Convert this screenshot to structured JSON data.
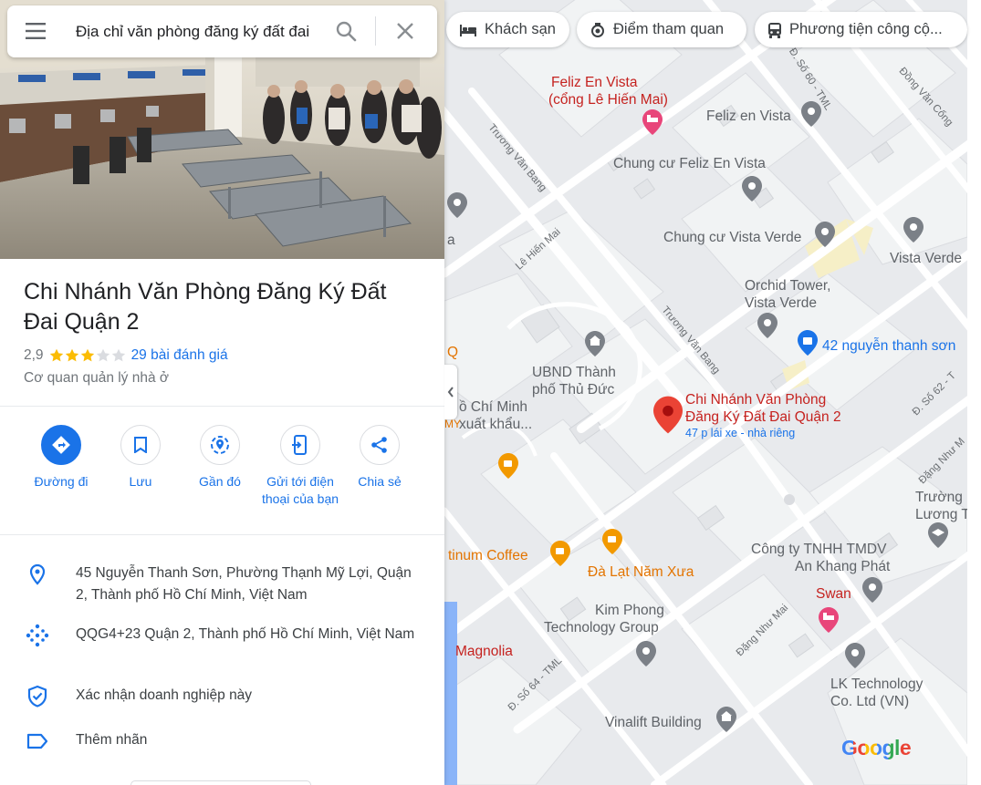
{
  "search": {
    "query": "Địa chỉ văn phòng đăng ký đất đai"
  },
  "chips": [
    {
      "label": "Khách sạn",
      "icon": "bed-icon"
    },
    {
      "label": "Điểm tham quan",
      "icon": "camera-icon"
    },
    {
      "label": "Phương tiện công cộ...",
      "icon": "bus-icon"
    }
  ],
  "place": {
    "title": "Chi Nhánh Văn Phòng Đăng Ký Đất Đai Quận 2",
    "rating": "2,9",
    "rating_value": 2.9,
    "reviews": "29 bài đánh giá",
    "category": "Cơ quan quản lý nhà ở"
  },
  "actions": [
    {
      "label": "Đường đi",
      "icon": "directions-icon"
    },
    {
      "label": "Lưu",
      "icon": "bookmark-icon"
    },
    {
      "label": "Gần đó",
      "icon": "nearby-icon"
    },
    {
      "label": "Gửi tới điện thoại của bạn",
      "icon": "send-to-phone-icon"
    },
    {
      "label": "Chia sẻ",
      "icon": "share-icon"
    }
  ],
  "info": {
    "address": "45 Nguyễn Thanh Sơn, Phường Thạnh Mỹ Lợi, Quận 2, Thành phố Hồ Chí Minh, Việt Nam",
    "plus_code": "QQG4+23 Quận 2, Thành phố Hồ Chí Minh, Việt Nam",
    "claim": "Xác nhận doanh nghiệp này",
    "label": "Thêm nhãn"
  },
  "map": {
    "pois": {
      "feliz_hotel_1": "Feliz En Vista",
      "feliz_hotel_2": "(cổng Lê Hiến Mai)",
      "feliz_en_vista": "Feliz en Vista",
      "cc_feliz": "Chung cư Feliz En Vista",
      "cc_vista_verde": "Chung cư Vista Verde",
      "vista_verde": "Vista Verde",
      "orchid_1": "Orchid Tower,",
      "orchid_2": "Vista Verde",
      "nguyen_thanh_son": "42 nguyễn thanh sơn",
      "ubnd_1": "UBND Thành",
      "ubnd_2": "phố Thủ Đức",
      "target_1": "Chi Nhánh Văn Phòng",
      "target_2": "Đăng Ký Đất Đai Quận 2",
      "target_sub": "47 p lái xe - nhà riêng",
      "hcm_1": "ồ Chí Minh",
      "hcm_2": "xuất khẩu...",
      "truong_1": "Trường",
      "truong_2": "Lương T",
      "platinum": "tinum Coffee",
      "dalat": "Đà Lạt Năm Xưa",
      "cty_1": "Công ty TNHH TMDV",
      "cty_2": "An Khang Phát",
      "swan": "Swan",
      "kimphong_1": "Kim Phong",
      "kimphong_2": "Technology Group",
      "magnolia": "Magnolia",
      "lk_1": "LK Technology",
      "lk_2": "Co. Ltd (VN)",
      "vinalift": "Vinalift Building",
      "q_edge": "Q",
      "a_edge": "a",
      "my_edge": "MY"
    },
    "streets": {
      "truong_van_bang_1": "Trương Văn Bang",
      "truong_van_bang_2": "Trương Văn Bang",
      "le_hien_mai": "Lê Hiến Mai",
      "d_so_60": "Đ. Số 60 - TML",
      "dong_van_cong": "Đồng Văn Cống",
      "d_so_62": "Đ. Số 62 - T",
      "dang_nhu_mai_1": "Đặng Như M",
      "dang_nhu_mai_2": "Đặng Như Mai",
      "d_so_64": "Đ. Số 64 - TML"
    },
    "logo": "Google"
  },
  "colors": {
    "accent": "#1a73e8",
    "pin_red": "#ea4335",
    "poi_orange": "#e37400",
    "poi_pink": "#e8467a"
  }
}
